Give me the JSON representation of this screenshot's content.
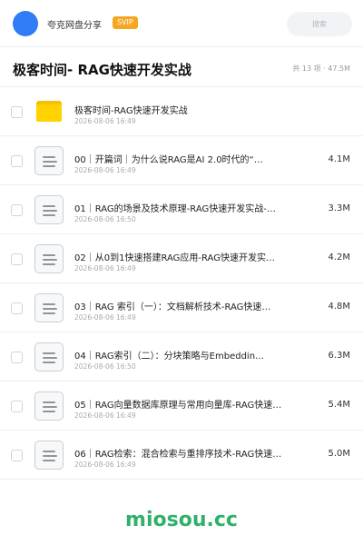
{
  "topbar": {
    "brand": "夸克网盘分享",
    "badge": "SVIP",
    "search_placeholder": "搜索"
  },
  "header": {
    "title": "极客时间- RAG快速开发实战",
    "meta": "共 13 项 · 47.5M"
  },
  "files": [
    {
      "type": "folder",
      "name": "极客时间-RAG快速开发实战",
      "date": "2026-08-06 16:49",
      "size": ""
    },
    {
      "type": "doc",
      "name": "00｜开篇词｜为什么说RAG是AI 2.0时代的“…",
      "date": "2026-08-06 16:49",
      "size": "4.1M"
    },
    {
      "type": "doc",
      "name": "01｜RAG的场景及技术原理-RAG快速开发实战-…",
      "date": "2026-08-06 16:50",
      "size": "3.3M"
    },
    {
      "type": "doc",
      "name": "02｜从0到1快速搭建RAG应用-RAG快速开发实…",
      "date": "2026-08-06 16:49",
      "size": "4.2M"
    },
    {
      "type": "doc",
      "name": "03｜RAG 索引（一）：文档解析技术-RAG快速…",
      "date": "2026-08-06 16:49",
      "size": "4.8M"
    },
    {
      "type": "doc",
      "name": "04｜RAG索引（二）：分块策略与Embeddin…",
      "date": "2026-08-06 16:50",
      "size": "6.3M"
    },
    {
      "type": "doc",
      "name": "05｜RAG向量数据库原理与常用向量库-RAG快速…",
      "date": "2026-08-06 16:49",
      "size": "5.4M"
    },
    {
      "type": "doc",
      "name": "06｜RAG检索：混合检索与重排序技术-RAG快速…",
      "date": "2026-08-06 16:49",
      "size": "5.0M"
    }
  ],
  "watermark": "miosou.cc"
}
